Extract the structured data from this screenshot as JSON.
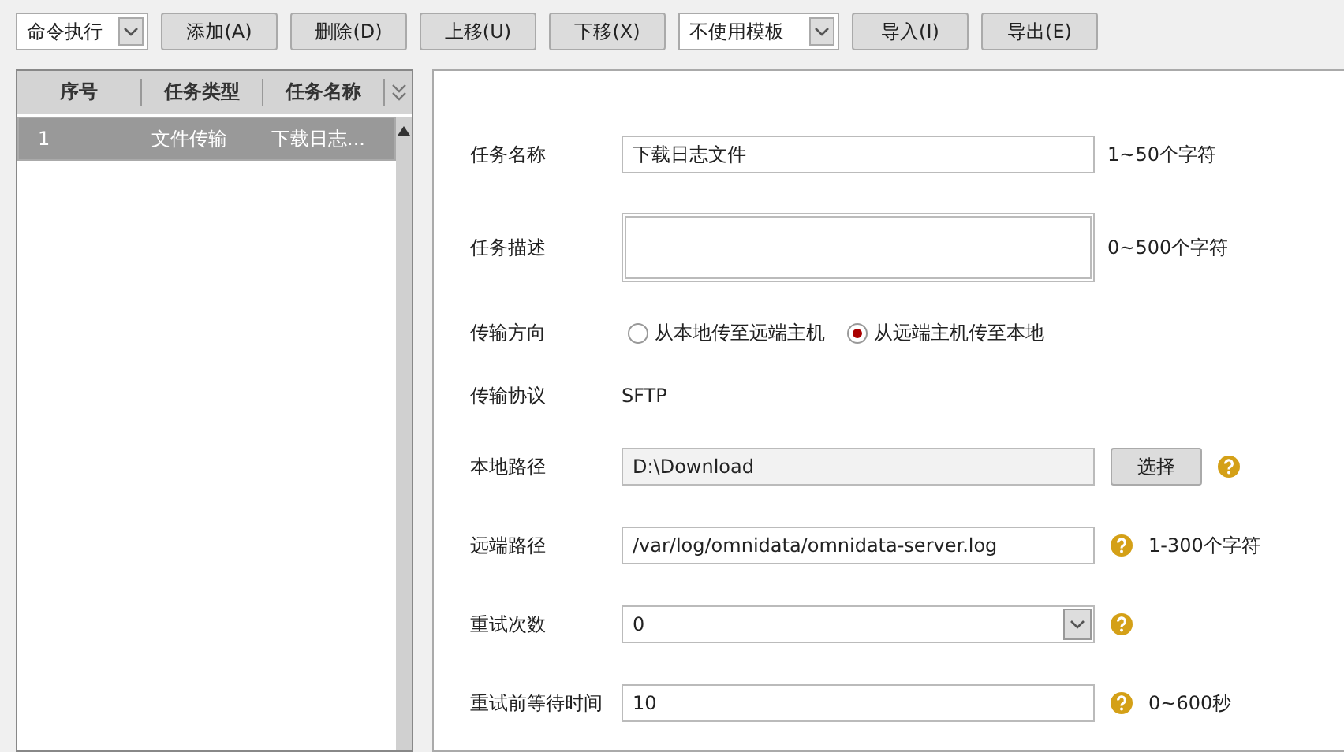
{
  "toolbar": {
    "mode": "命令执行",
    "buttons": [
      "添加(A)",
      "删除(D)",
      "上移(U)",
      "下移(X)"
    ],
    "template": "不使用模板",
    "buttons2": [
      "导入(I)",
      "导出(E)"
    ]
  },
  "task_list": {
    "columns": [
      "序号",
      "任务类型",
      "任务名称"
    ],
    "rows": [
      {
        "cells": [
          "1",
          "文件传输",
          "下载日志..."
        ],
        "selected": true
      }
    ]
  },
  "form": [
    {
      "kind": "text",
      "label": "任务名称",
      "value": "下载日志文件",
      "hint": "1~50个字符"
    },
    {
      "kind": "textarea",
      "label": "任务描述",
      "hint": "0~500个字符"
    },
    {
      "kind": "radio",
      "label": "传输方向",
      "options": [
        {
          "label": "从本地传至远端主机",
          "selected": false
        },
        {
          "label": "从远端主机传至本地",
          "selected": true
        }
      ]
    },
    {
      "kind": "static",
      "label": "传输协议",
      "value": "SFTP"
    },
    {
      "kind": "readonly",
      "label": "本地路径",
      "value": "D:\\Download",
      "button": "选择",
      "help": true
    },
    {
      "kind": "text",
      "label": "远端路径",
      "value": "/var/log/omnidata/omnidata-server.log",
      "help": true,
      "hint": "1-300个字符"
    },
    {
      "kind": "select",
      "label": "重试次数",
      "value": "0",
      "help": true
    },
    {
      "kind": "text",
      "label": "重试前等待时间",
      "value": "10",
      "help": true,
      "hint": "0~600秒"
    }
  ]
}
